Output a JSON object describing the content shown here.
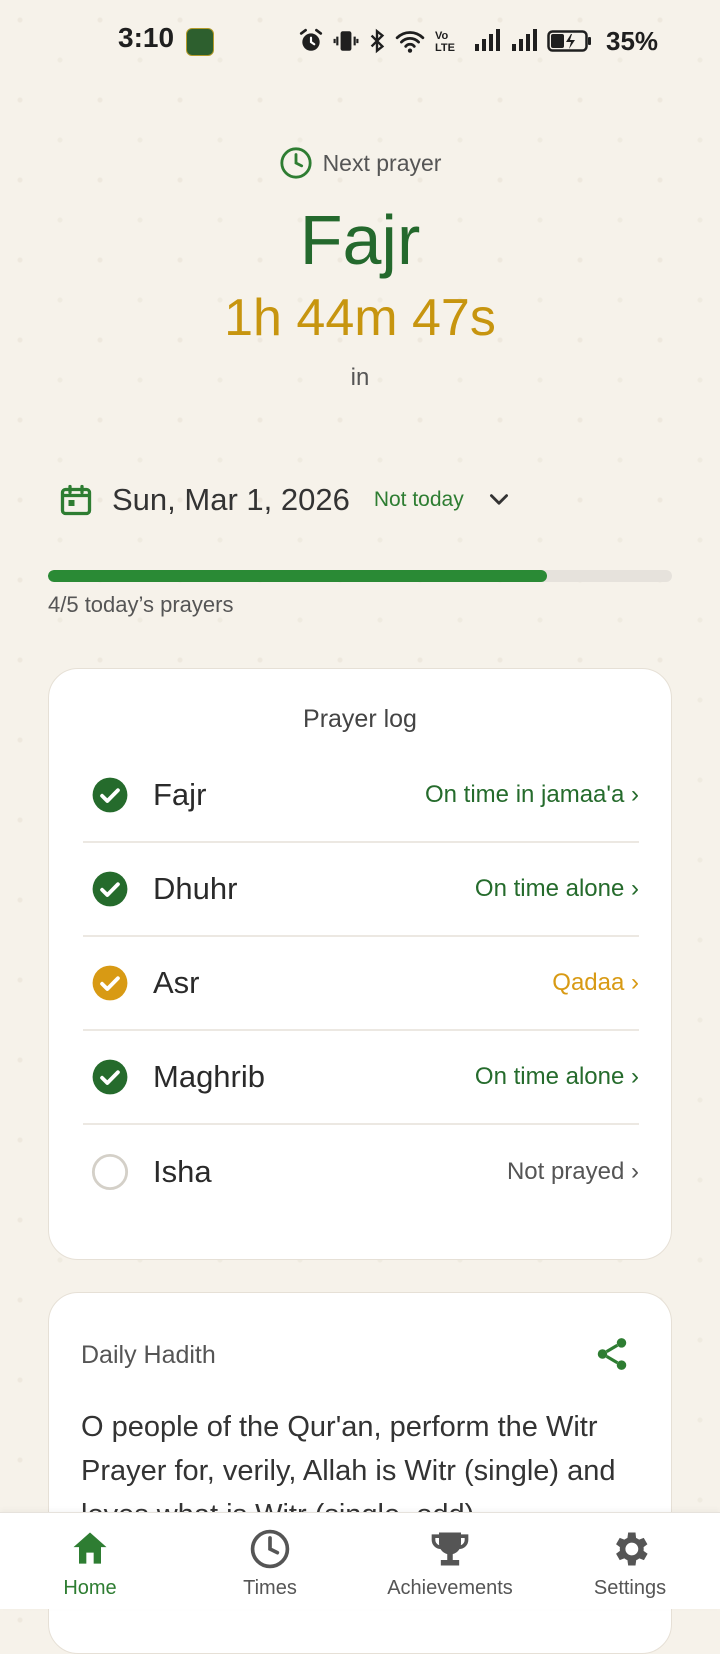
{
  "status_bar": {
    "time": "3:10",
    "battery": "35%"
  },
  "next_prayer": {
    "label": "Next prayer",
    "name": "Fajr",
    "countdown": "1h 44m 47s",
    "in_label": "in"
  },
  "date_row": {
    "date": "Sun, Mar 1, 2026",
    "badge": "Not today"
  },
  "progress": {
    "completed": 4,
    "total": 5,
    "fraction": 0.8,
    "label": "4/5 today’s prayers"
  },
  "prayer_log": {
    "title": "Prayer log",
    "items": [
      {
        "name": "Fajr",
        "status": "On time in jamaa'a ›",
        "state": "done",
        "color": "#256b2c"
      },
      {
        "name": "Dhuhr",
        "status": "On time alone ›",
        "state": "done",
        "color": "#256b2c"
      },
      {
        "name": "Asr",
        "status": "Qadaa ›",
        "state": "qadaa",
        "color": "#d89a14"
      },
      {
        "name": "Maghrib",
        "status": "On time alone ›",
        "state": "done",
        "color": "#256b2c"
      },
      {
        "name": "Isha",
        "status": "Not prayed ›",
        "state": "none",
        "color": "#555555"
      }
    ]
  },
  "hadith": {
    "title": "Daily Hadith",
    "text": "O people of the Qur'an, perform the Witr Prayer for, verily, Allah is Witr (single) and loves what is Witr (single, odd)."
  },
  "nav": {
    "home": "Home",
    "times": "Times",
    "achievements": "Achievements",
    "settings": "Settings"
  },
  "colors": {
    "primary_green": "#2e7d32",
    "accent_gold": "#c7950f",
    "background": "#f6f2ea"
  }
}
